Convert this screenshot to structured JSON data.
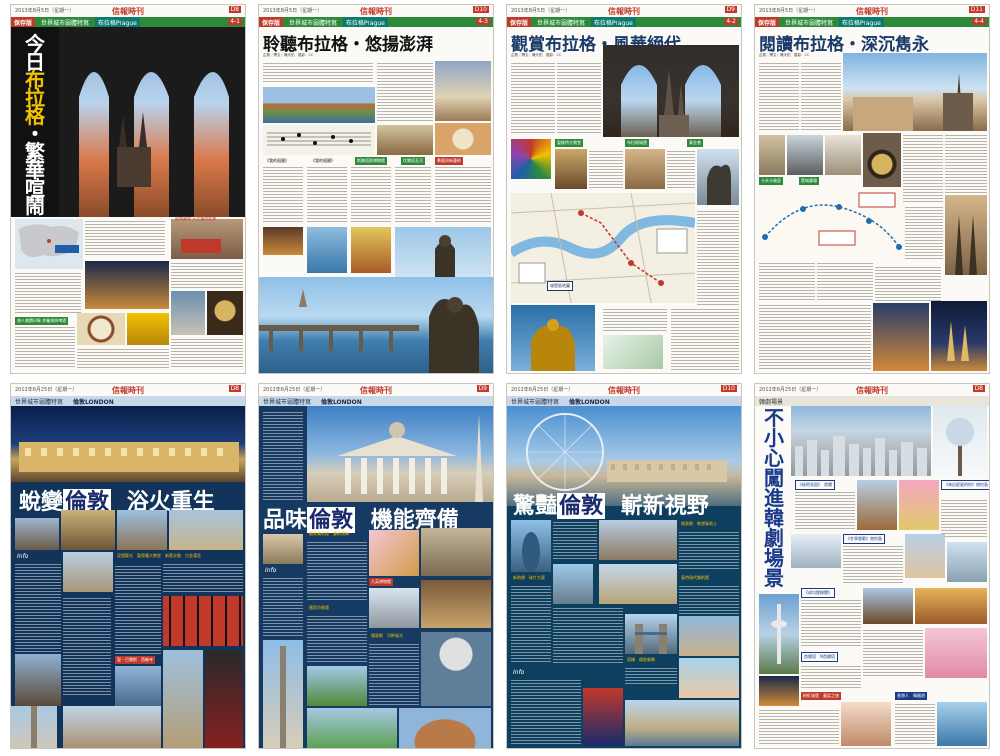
{
  "pages": [
    {
      "id": "prague-4-1",
      "date": "2013年8月5日（星期一）",
      "logo": "信報時刊",
      "page_no": "D8",
      "banner_box": "保存版",
      "banner_text1": "世界城市弱體特寫",
      "banner_text2": "布拉格Prague",
      "banner_code": "4-1",
      "headline_chars": [
        "今",
        "日",
        "布",
        "拉",
        "格",
        "・",
        "繁",
        "華",
        "喧",
        "鬧"
      ],
      "sub": "企劃／撰文：陳天佑",
      "labels": [
        "舊城廣場 天文鐘與前景",
        "布拉格 歐陸心臟",
        "查理大橋 遊人之地",
        "旅人美饌印象 炸豬排與啤酒"
      ]
    },
    {
      "id": "prague-4-3",
      "date": "2013年8月5日（星期一）",
      "logo": "信報時刊",
      "page_no": "D10",
      "banner_box": "保存版",
      "banner_text1": "世界城市弱體特寫",
      "banner_text2": "布拉格Prague",
      "banner_code": "4-3",
      "headline": "聆聽布拉格・悠揚澎湃",
      "sub": "企劃／撰文：陳天佑　攝影：CC",
      "labels": [
        "《我的祖國》",
        "《我的祖國》",
        "斯美塔那博物館",
        "伏爾塔瓦河",
        "慕夏與新藝術",
        "音樂之都　歌劇院巡禮"
      ]
    },
    {
      "id": "prague-4-2",
      "date": "2013年8月5日（星期一）",
      "logo": "信報時刊",
      "page_no": "D9",
      "banner_box": "保存版",
      "banner_text1": "世界城市弱體特寫",
      "banner_text2": "布拉格Prague",
      "banner_code": "4-2",
      "headline": "觀賞布拉格・風華絕代",
      "sub": "企劃／撰文：陳天佑　攝影：CC",
      "labels": [
        "聖維特大教堂",
        "布拉格城堡",
        "黃金巷",
        "查理大橋",
        "舊城廣場",
        "伏爾塔瓦河",
        "城堡區地圖"
      ]
    },
    {
      "id": "prague-4-4",
      "date": "2013年8月5日（星期一）",
      "logo": "信報時刊",
      "page_no": "D11",
      "banner_box": "保存版",
      "banner_text1": "世界城市弱體特寫",
      "banner_text2": "布拉格Prague",
      "banner_code": "4-4",
      "headline": "閱讀布拉格・深沉雋永",
      "sub": "企劃／撰文：陳天佑　攝影：CC",
      "labels": [
        "卡夫卡故居",
        "舊城廣場",
        "天文鐘",
        "猶太區",
        "舊猶太墓園",
        "布拉格城堡",
        "卡夫卡博物館",
        "查理大學"
      ]
    },
    {
      "id": "london-1",
      "date": "2012年6月25日（星期一）",
      "logo": "信報時刊",
      "page_no": "D8",
      "banner_text1": "世界城市弱體特寫",
      "banner_text2": "倫敦LONDON",
      "headline_a": "蛻變",
      "headline_b": "倫敦",
      "headline_c": "浴火重生",
      "labels": [
        "Info",
        "見證榮光　聖保羅大教堂",
        "新舊交融　白金漢宮",
        "聖・巴爾斯　西敏寺"
      ]
    },
    {
      "id": "london-2",
      "date": "2012年6月25日（星期一）",
      "logo": "信報時刊",
      "page_no": "D9",
      "banner_text1": "世界城市弱體特寫",
      "banner_text2": "倫敦LONDON",
      "headline_a": "品味",
      "headline_b": "倫敦",
      "headline_c": "機能齊備",
      "labels": [
        "Info",
        "國家美術館　藝術寶庫",
        "大英博物館",
        "國家肖像館",
        "倫敦眼　河畔風光"
      ]
    },
    {
      "id": "london-3",
      "date": "2012年6月25日（星期一）",
      "logo": "信報時刊",
      "page_no": "D10",
      "banner_text1": "世界城市弱體特寫",
      "banner_text2": "倫敦LONDON",
      "headline_a": "驚豔",
      "headline_b": "倫敦",
      "headline_c": "嶄新視野",
      "labels": [
        "Info",
        "倫敦眼　眺望泰晤士",
        "新地標　碎片大廈",
        "泰特現代美術館",
        "塔橋　倫敦象徵"
      ]
    },
    {
      "id": "korea",
      "date": "2012年6月25日（星期一）",
      "logo": "信報時刊",
      "page_no": "D8",
      "banner_text1": "韓劇場景",
      "headline_chars": [
        "不",
        "小",
        "心",
        "闖",
        "進",
        "韓",
        "劇",
        "場",
        "景"
      ],
      "labels": [
        "《秘密花園》　首爾",
        "《來自星星的你》南怡島",
        "《冬季戀歌》南怡島",
        "《成均館緋聞》",
        "首爾塔　N首爾塔",
        "粉紅城堡　童話之旅",
        "香港人　韓國遊"
      ]
    }
  ],
  "colors": {
    "prague_green": "#2d8a3b",
    "accent_red": "#c0392b",
    "london_navy": "#1a2a6c",
    "korea_blue": "#1a3a8a"
  }
}
